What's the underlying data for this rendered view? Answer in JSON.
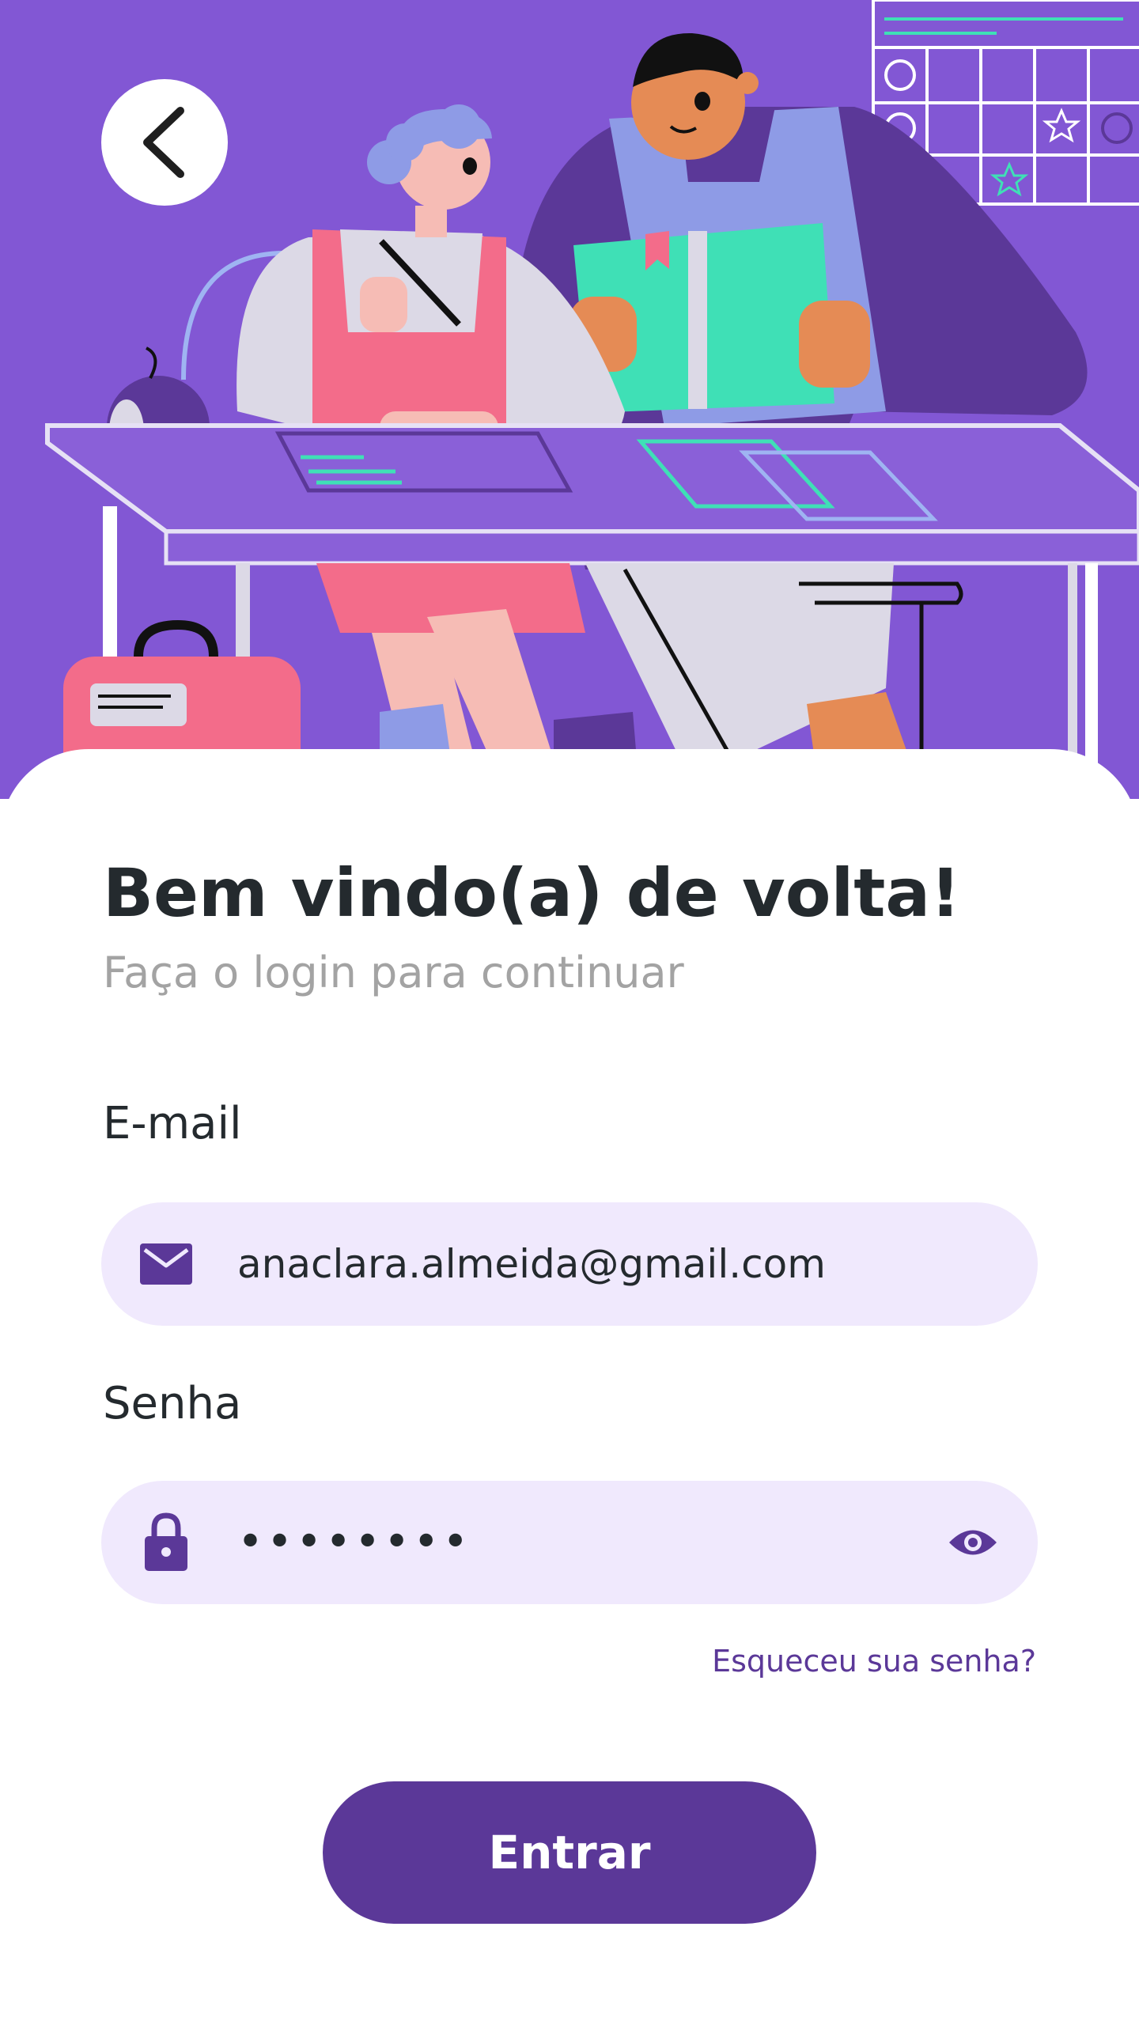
{
  "colors": {
    "hero_background": "#8257d4",
    "primary": "#5b3898",
    "field_background": "#f0e9fd",
    "text_dark": "#242a2e",
    "text_muted": "#a3a3a3"
  },
  "header": {
    "back_icon": "chevron-left-icon",
    "illustration": "students-studying-at-desk"
  },
  "login": {
    "title": "Bem vindo(a) de volta!",
    "subtitle": "Faça o login para continuar",
    "email": {
      "label": "E-mail",
      "icon": "envelope-icon",
      "value": "anaclara.almeida@gmail.com"
    },
    "password": {
      "label": "Senha",
      "icon": "lock-icon",
      "value": "••••••••",
      "toggle_icon": "eye-icon"
    },
    "forgot_password": "Esqueceu sua senha?",
    "submit": "Entrar"
  }
}
